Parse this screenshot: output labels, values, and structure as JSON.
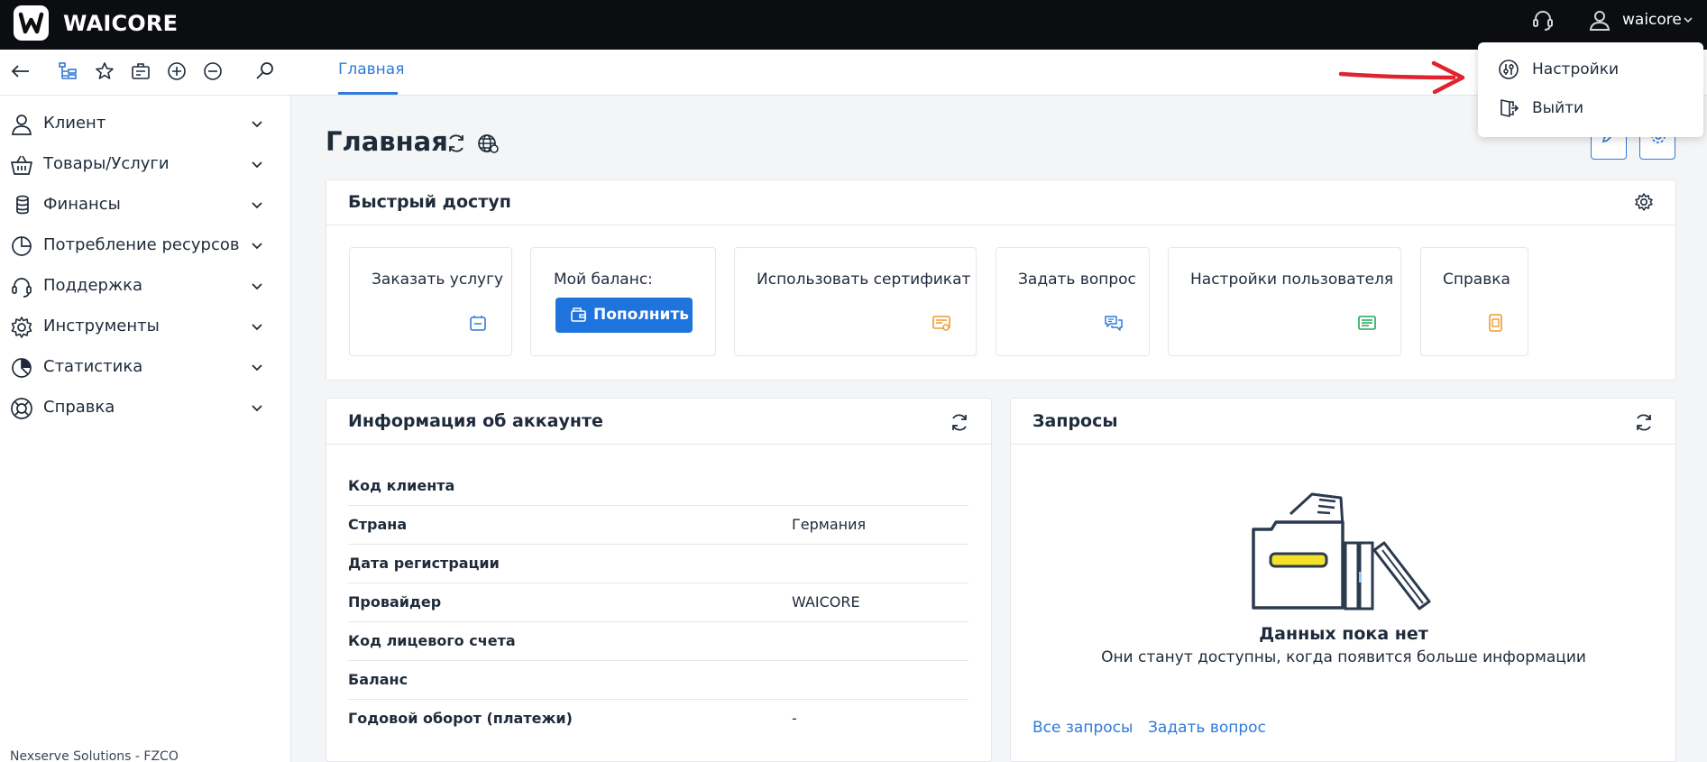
{
  "app": {
    "name": "WAICORE"
  },
  "topbar": {
    "username": "waicore",
    "support_icon": "headset-icon",
    "user_icon": "user-icon"
  },
  "toolbar": {
    "tab_main": "Главная"
  },
  "sidebar": {
    "items": [
      {
        "label": "Клиент",
        "icon": "client-icon"
      },
      {
        "label": "Товары/Услуги",
        "icon": "basket-icon"
      },
      {
        "label": "Финансы",
        "icon": "coins-icon"
      },
      {
        "label": "Потребление ресурсов",
        "icon": "pie-chart-icon"
      },
      {
        "label": "Поддержка",
        "icon": "headset-icon"
      },
      {
        "label": "Инструменты",
        "icon": "gear-icon"
      },
      {
        "label": "Статистика",
        "icon": "stats-icon"
      },
      {
        "label": "Справка",
        "icon": "lifebuoy-icon"
      }
    ],
    "footer": "Nexserve Solutions - FZCO"
  },
  "page": {
    "title": "Главная"
  },
  "quick_access": {
    "title": "Быстрый доступ",
    "tiles": [
      {
        "label": "Заказать услугу",
        "icon": "order-icon"
      },
      {
        "label": "Мой баланс:",
        "button": "Пополнить"
      },
      {
        "label": "Использовать сертификат",
        "icon": "certificate-icon"
      },
      {
        "label": "Задать вопрос",
        "icon": "chat-icon"
      },
      {
        "label": "Настройки пользователя",
        "icon": "user-settings-icon"
      },
      {
        "label": "Справка",
        "icon": "document-icon"
      }
    ]
  },
  "account_info": {
    "title": "Информация об аккаунте",
    "rows": [
      {
        "key": "Код клиента",
        "value": ""
      },
      {
        "key": "Страна",
        "value": "Германия"
      },
      {
        "key": "Дата регистрации",
        "value": ""
      },
      {
        "key": "Провайдер",
        "value": "WAICORE"
      },
      {
        "key": "Код лицевого счета",
        "value": ""
      },
      {
        "key": "Баланс",
        "value": ""
      },
      {
        "key": "Годовой оборот (платежи)",
        "value": "-"
      }
    ]
  },
  "requests": {
    "title": "Запросы",
    "empty_title": "Данных пока нет",
    "empty_subtitle": "Они станут доступны, когда появится больше информации",
    "link_all": "Все запросы",
    "link_ask": "Задать вопрос"
  },
  "dropdown": {
    "items": [
      {
        "label": "Настройки",
        "icon": "sliders-icon"
      },
      {
        "label": "Выйти",
        "icon": "logout-icon"
      }
    ]
  },
  "colors": {
    "accent": "#2f7ad8",
    "topbar": "#0b0d10",
    "button": "#1f73dc",
    "annotation_arrow": "#e0232e"
  }
}
